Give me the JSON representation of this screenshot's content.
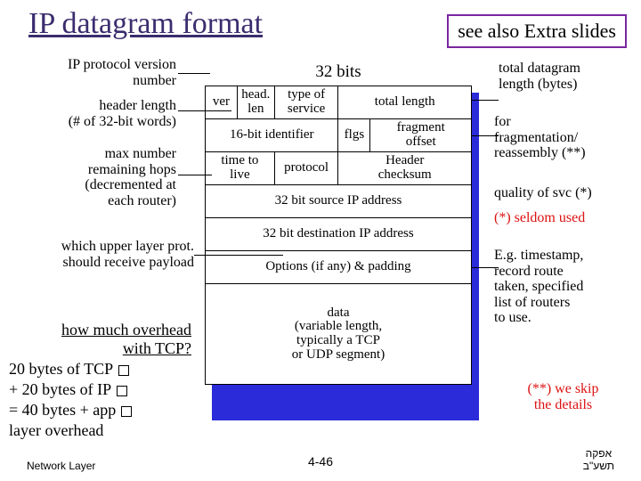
{
  "title": "IP datagram format",
  "see_also": "see also Extra slides",
  "bits_label": "32 bits",
  "left_annotations": {
    "version": "IP protocol version\nnumber",
    "hlen": "header length\n(# of 32-bit words)",
    "ttl": "max number\nremaining hops\n(decremented at\neach router)",
    "upper_layer": "which upper layer prot.\nshould receive payload"
  },
  "right_annotations": {
    "total_len": "total datagram\nlength (bytes)",
    "frag": "for\nfragmentation/\nreassembly (**)",
    "qos": "quality of svc (*)",
    "seldom": "(*) seldom used",
    "options": "E.g. timestamp,\nrecord route\ntaken, specified\nlist of routers\nto use.",
    "skip": "(**) we skip\nthe details"
  },
  "header_fields": {
    "ver": "ver",
    "hlen": "head.\nlen",
    "tos": "type of\nservice",
    "total_length": "total length",
    "id": "16-bit identifier",
    "flgs": "flgs",
    "frag_offset": "fragment\noffset",
    "ttl": "time to\nlive",
    "proto": "protocol",
    "checksum": "Header\nchecksum",
    "src": "32 bit source IP address",
    "dst": "32 bit destination IP address",
    "options": "Options (if any) & padding",
    "data": "data\n(variable length,\ntypically a TCP\nor UDP segment)"
  },
  "overhead": {
    "q1": "how much overhead",
    "q2": "with TCP?",
    "l1": "20 bytes of TCP",
    "l2": "+ 20 bytes of IP",
    "l3": "= 40 bytes + app",
    "l4": "  layer overhead"
  },
  "footer": {
    "left": "Network Layer",
    "page": "4-46",
    "hebrew": "אפקה\nתשע\"ב"
  },
  "chart_data": {
    "type": "table",
    "title": "IPv4 header layout (each row = 32 bits)",
    "rows": [
      [
        {
          "field": "ver",
          "bits": 4,
          "note": "IP protocol version number"
        },
        {
          "field": "head. len",
          "bits": 4,
          "note": "header length (# of 32-bit words)"
        },
        {
          "field": "type of service",
          "bits": 8,
          "note": "quality of svc (*) — seldom used"
        },
        {
          "field": "total length",
          "bits": 16,
          "note": "total datagram length (bytes)"
        }
      ],
      [
        {
          "field": "16-bit identifier",
          "bits": 16,
          "note": "for fragmentation/reassembly (**)"
        },
        {
          "field": "flgs",
          "bits": 3,
          "note": "for fragmentation/reassembly (**)"
        },
        {
          "field": "fragment offset",
          "bits": 13,
          "note": "for fragmentation/reassembly (**)"
        }
      ],
      [
        {
          "field": "time to live",
          "bits": 8,
          "note": "max number remaining hops (decremented at each router)"
        },
        {
          "field": "protocol",
          "bits": 8,
          "note": "which upper layer prot. should receive payload"
        },
        {
          "field": "Header checksum",
          "bits": 16
        }
      ],
      [
        {
          "field": "32 bit source IP address",
          "bits": 32
        }
      ],
      [
        {
          "field": "32 bit destination IP address",
          "bits": 32
        }
      ],
      [
        {
          "field": "Options (if any) & padding",
          "bits": 32
        }
      ],
      [
        {
          "field": "data (variable length, typically a TCP or UDP segment)",
          "bits": 32
        }
      ]
    ],
    "overhead_calc": {
      "tcp_header_bytes": 20,
      "ip_header_bytes": 20,
      "total_bytes": 40,
      "plus": "app layer overhead"
    },
    "footnotes": {
      "*": "seldom used",
      "**": "we skip the details"
    }
  }
}
